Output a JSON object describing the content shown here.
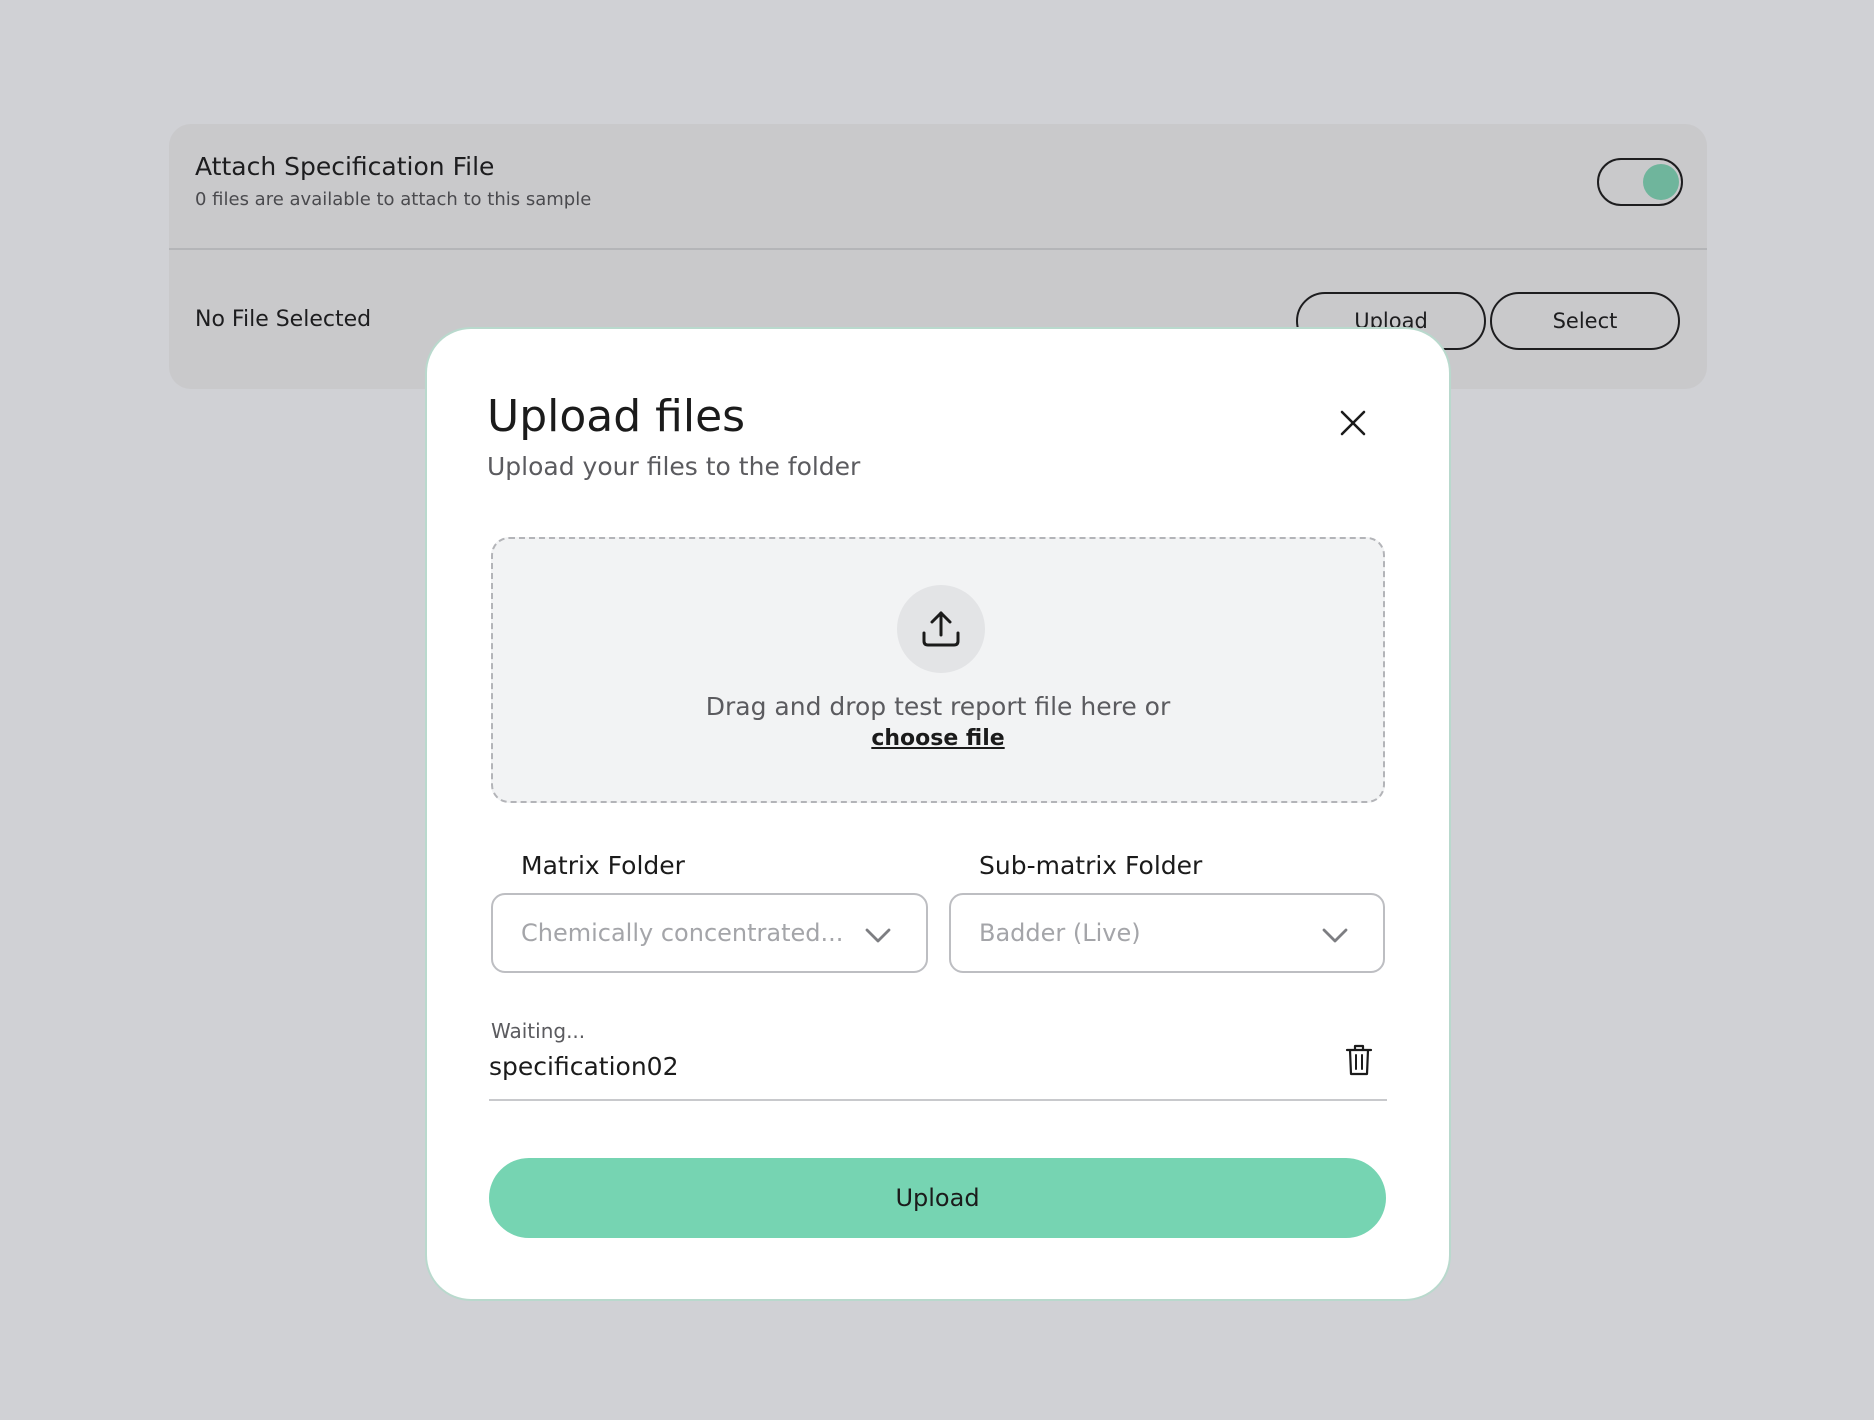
{
  "attach_card": {
    "title": "Attach Specification File",
    "subtitle": "0 files are available to attach to this sample",
    "toggle_on": true,
    "toggle_color": "#6fb59c",
    "selection_status": "No File Selected",
    "upload_label": "Upload",
    "select_label": "Select"
  },
  "modal": {
    "title": "Upload files",
    "subtitle": "Upload your files to the folder",
    "close_icon": "close-icon",
    "dropzone": {
      "icon": "upload-icon",
      "prompt": "Drag and drop test report file here or",
      "choose_link": "choose file"
    },
    "matrix_folder": {
      "label": "Matrix Folder",
      "value": "Chemically concentrated..."
    },
    "submatrix_folder": {
      "label": "Sub-matrix Folder",
      "value": "Badder (Live)"
    },
    "file": {
      "status": "Waiting...",
      "name": "specification02",
      "delete_icon": "trash-icon"
    },
    "upload_button": "Upload",
    "accent_color": "#76d4b2"
  }
}
